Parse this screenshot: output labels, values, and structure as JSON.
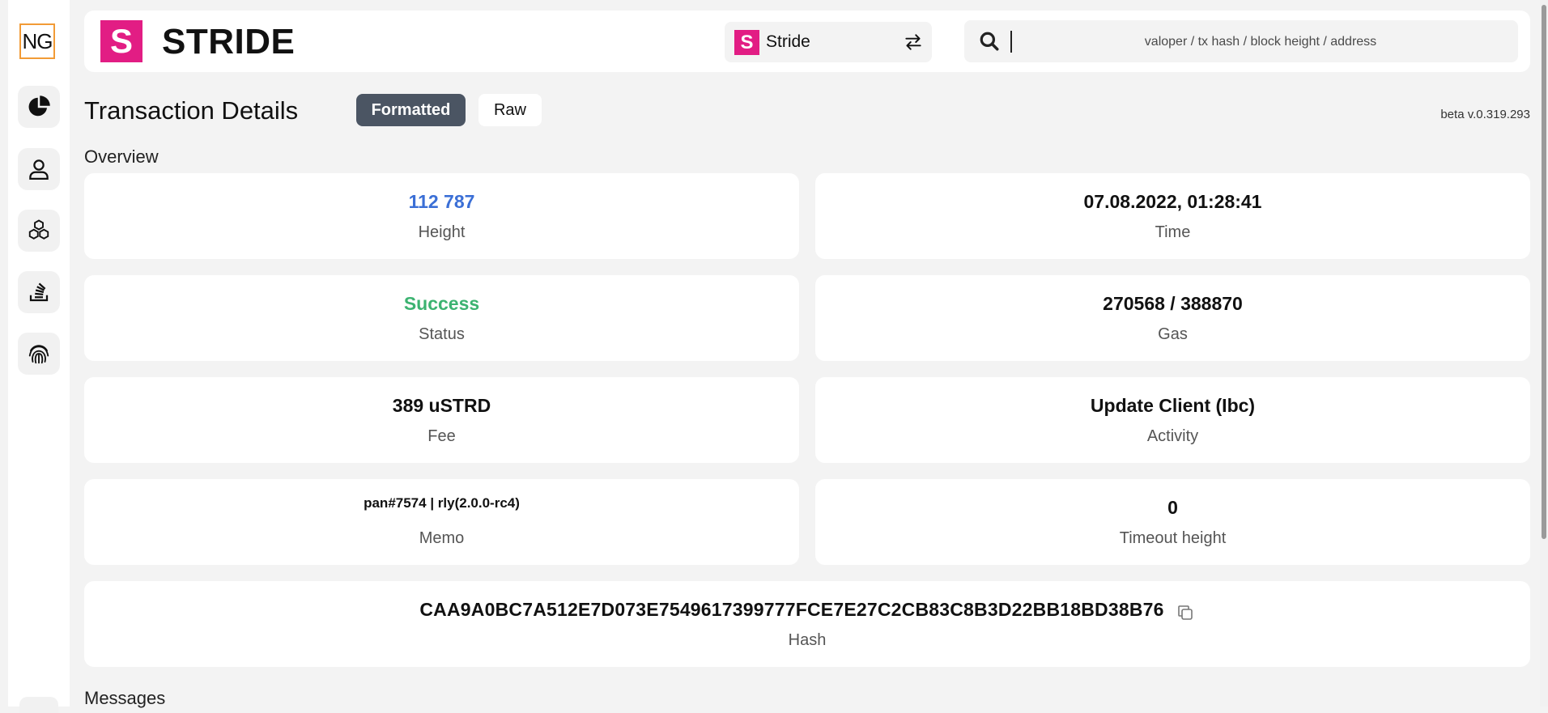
{
  "sidebar": {
    "logo": "NG",
    "items": [
      {
        "icon": "pie-chart-icon"
      },
      {
        "icon": "user-icon"
      },
      {
        "icon": "blocks-icon"
      },
      {
        "icon": "stack-icon"
      },
      {
        "icon": "fingerprint-icon"
      }
    ]
  },
  "header": {
    "brand_letter": "S",
    "brand_name": "STRIDE",
    "chain_letter": "S",
    "chain_name": "Stride",
    "search_placeholder": "valoper / tx hash / block height / address"
  },
  "page": {
    "title": "Transaction Details",
    "tabs": [
      {
        "label": "Formatted",
        "active": true
      },
      {
        "label": "Raw",
        "active": false
      }
    ],
    "version": "beta v.0.319.293",
    "overview_label": "Overview",
    "messages_label": "Messages"
  },
  "overview": {
    "height": {
      "value": "112 787",
      "label": "Height"
    },
    "time": {
      "value": "07.08.2022, 01:28:41",
      "label": "Time"
    },
    "status": {
      "value": "Success",
      "label": "Status"
    },
    "gas": {
      "value": "270568 / 388870",
      "label": "Gas"
    },
    "fee": {
      "value": "389 uSTRD",
      "label": "Fee"
    },
    "activity": {
      "value": "Update Client (Ibc)",
      "label": "Activity"
    },
    "memo": {
      "value": "pan#7574 | rly(2.0.0-rc4)",
      "label": "Memo"
    },
    "timeout": {
      "value": "0",
      "label": "Timeout height"
    },
    "hash": {
      "value": "CAA9A0BC7A512E7D073E7549617399777FCE7E27C2CB83C8B3D22BB18BD38B76",
      "label": "Hash"
    }
  },
  "colors": {
    "brand": "#e21d84",
    "link_blue": "#3b6fd6",
    "success_green": "#3cb371",
    "logo_border": "#f29b36"
  }
}
